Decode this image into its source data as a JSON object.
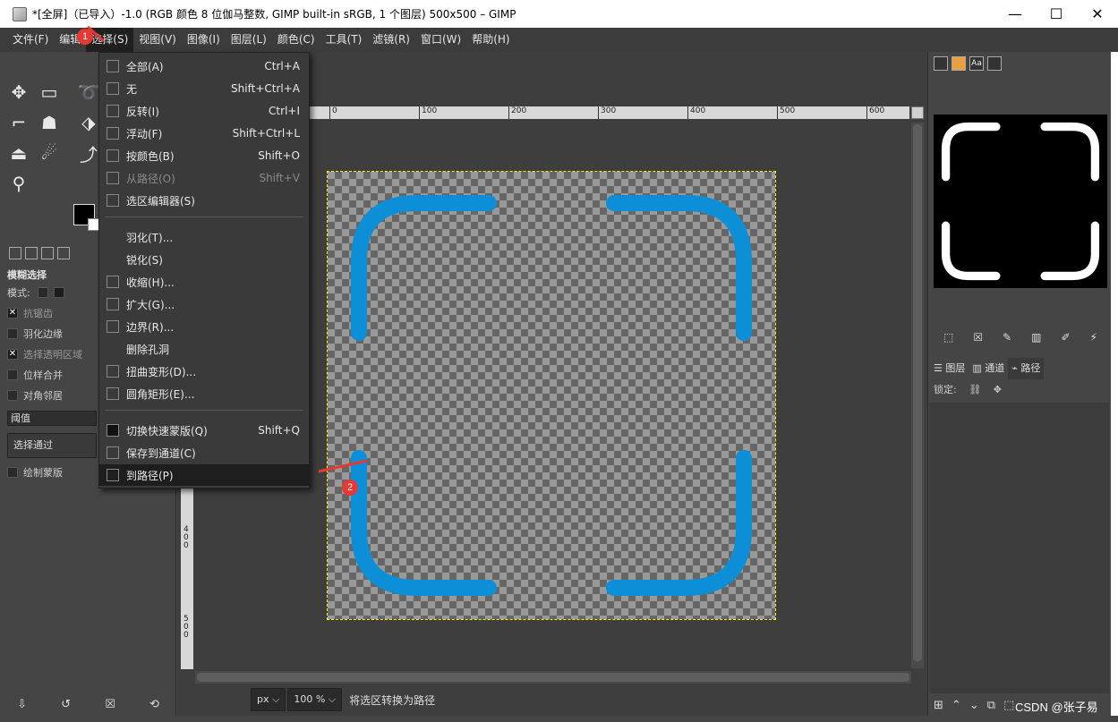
{
  "window": {
    "title": "*[全屏]（已导入）-1.0 (RGB 颜色 8 位伽马整数, GIMP built-in sRGB, 1 个图层) 500x500 – GIMP",
    "minimize": "—",
    "maximize": "☐",
    "close": "✕"
  },
  "menubar": [
    {
      "label": "文件(F)"
    },
    {
      "label": "编辑"
    },
    {
      "label": "选择(S)"
    },
    {
      "label": "视图(V)"
    },
    {
      "label": "图像(I)"
    },
    {
      "label": "图层(L)"
    },
    {
      "label": "颜色(C)"
    },
    {
      "label": "工具(T)"
    },
    {
      "label": "滤镜(R)"
    },
    {
      "label": "窗口(W)"
    },
    {
      "label": "帮助(H)"
    }
  ],
  "select_menu": {
    "items": [
      {
        "label": "全部(A)",
        "shortcut": "Ctrl+A"
      },
      {
        "label": "无",
        "shortcut": "Shift+Ctrl+A"
      },
      {
        "label": "反转(I)",
        "shortcut": "Ctrl+I"
      },
      {
        "label": "浮动(F)",
        "shortcut": "Shift+Ctrl+L"
      },
      {
        "label": "按颜色(B)",
        "shortcut": "Shift+O"
      },
      {
        "label": "从路径(O)",
        "shortcut": "Shift+V"
      },
      {
        "label": "选区编辑器(S)",
        "shortcut": ""
      },
      {
        "label": "羽化(T)...",
        "shortcut": ""
      },
      {
        "label": "锐化(S)",
        "shortcut": ""
      },
      {
        "label": "收缩(H)...",
        "shortcut": ""
      },
      {
        "label": "扩大(G)...",
        "shortcut": ""
      },
      {
        "label": "边界(R)...",
        "shortcut": ""
      },
      {
        "label": "删除孔洞",
        "shortcut": ""
      },
      {
        "label": "扭曲变形(D)...",
        "shortcut": ""
      },
      {
        "label": "圆角矩形(E)...",
        "shortcut": ""
      },
      {
        "label": "切换快速蒙版(Q)",
        "shortcut": "Shift+Q"
      },
      {
        "label": "保存到通道(C)",
        "shortcut": ""
      },
      {
        "label": "到路径(P)",
        "shortcut": ""
      }
    ]
  },
  "tool_options": {
    "title": "模糊选择",
    "mode_label": "模式:",
    "antialias": "抗锯齿",
    "feather": "羽化边缘",
    "select_transparent": "选择透明区域",
    "sample_merged": "位样合并",
    "diagonal": "对角邻居",
    "threshold_label": "阈值",
    "select_by": "选择通过",
    "draw_mask": "绘制蒙版"
  },
  "rulers": {
    "h_ticks": [
      "0",
      "100",
      "200",
      "300",
      "400",
      "500",
      "600"
    ],
    "v_ticks": [
      "400",
      "500"
    ]
  },
  "status": {
    "unit": "px",
    "zoom": "100 %",
    "message": "将选区转换为路径"
  },
  "dock": {
    "tab_text": "Aa",
    "layers_tab": "图层",
    "channels_tab": "通道",
    "paths_tab": "路径",
    "lock_label": "锁定:"
  },
  "annotations": {
    "badge1": "1",
    "badge2": "2",
    "watermark": "CSDN @张子易"
  },
  "colors": {
    "stroke_blue": "#0d8fd8",
    "selection": "#ffff00"
  }
}
